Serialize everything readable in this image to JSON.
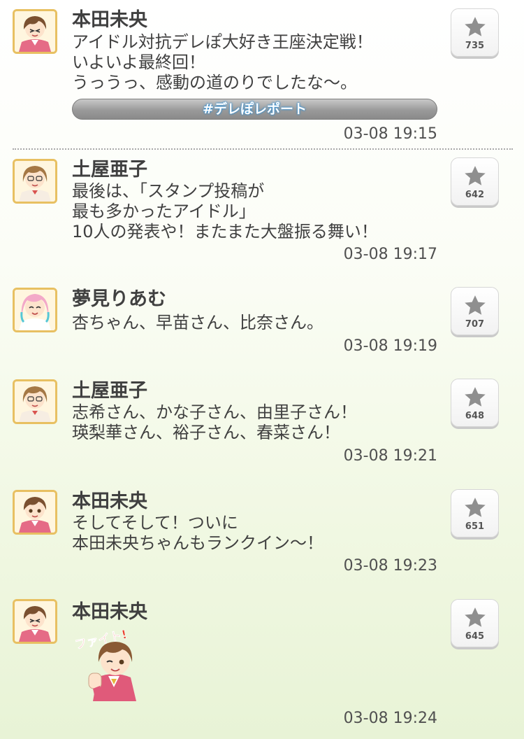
{
  "posts": [
    {
      "author": "本田未央",
      "avatar_icon": "mio-honda-avatar",
      "message": "アイドル対抗デレぽ大好き王座決定戦！\nいよいよ最終回！\nうっうっ、感動の道のりでしたな〜。",
      "hashtag": "#デレぽレポート",
      "time": "03-08 19:15",
      "likes": "735"
    },
    {
      "author": "土屋亜子",
      "avatar_icon": "ako-tsuchiya-avatar",
      "message": "最後は、「スタンプ投稿が\n最も多かったアイドル」\n10人の発表や！またまた大盤振る舞い！",
      "time": "03-08 19:17",
      "likes": "642"
    },
    {
      "author": "夢見りあむ",
      "avatar_icon": "riamu-yumemi-avatar",
      "message": "杏ちゃん、早苗さん、比奈さん。",
      "time": "03-08 19:19",
      "likes": "707"
    },
    {
      "author": "土屋亜子",
      "avatar_icon": "ako-tsuchiya-avatar",
      "message": "志希さん、かな子さん、由里子さん！\n瑛梨華さん、裕子さん、春菜さん！",
      "time": "03-08 19:21",
      "likes": "648"
    },
    {
      "author": "本田未央",
      "avatar_icon": "mio-honda-avatar",
      "message": "そしてそして！ついに\n本田未央ちゃんもランクイン〜！",
      "time": "03-08 19:23",
      "likes": "651"
    },
    {
      "author": "本田未央",
      "avatar_icon": "mio-honda-avatar",
      "sticker_text": "ファイト!",
      "time": "03-08 19:24",
      "likes": "645"
    }
  ],
  "colors": {
    "star": "#8f8f8f",
    "hashtag_glow": "#2e8fd6",
    "avatar_border": "#e8c062"
  }
}
